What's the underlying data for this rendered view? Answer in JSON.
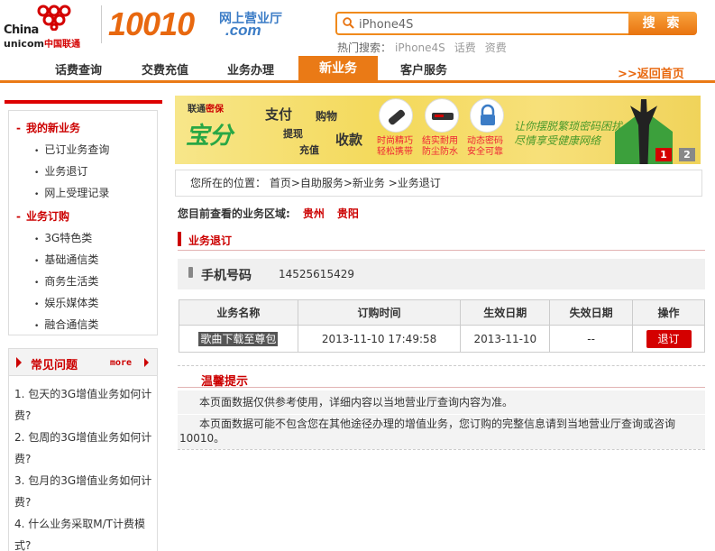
{
  "brand": {
    "china": "China",
    "unicom": "unicom",
    "unicom_cn": "中国联通",
    "number": "10010",
    "top": "网上营业厅",
    "com": ".com"
  },
  "search": {
    "value": "iPhone4S",
    "button": "搜 索",
    "hot_label": "热门搜索：",
    "hot": [
      "iPhone4S",
      "话费",
      "资费"
    ]
  },
  "nav": {
    "items": [
      "话费查询",
      "交费充值",
      "业务办理",
      "新业务",
      "客户服务"
    ],
    "home": ">>返回首页"
  },
  "sidebar": {
    "my_business": "我的新业务",
    "my_items": [
      "已订业务查询",
      "业务退订",
      "网上受理记录"
    ],
    "order": "业务订购",
    "order_items": [
      "3G特色类",
      "基础通信类",
      "商务生活类",
      "娱乐媒体类",
      "融合通信类"
    ]
  },
  "faq": {
    "title": "常见问题",
    "more": "more",
    "items": [
      "1. 包天的3G增值业务如何计费?",
      "2. 包周的3G增值业务如何计费?",
      "3. 包月的3G增值业务如何计费?",
      "4. 什么业务采取M/T计费模式?"
    ]
  },
  "banner": {
    "logo_a": "联通",
    "logo_b": "密保",
    "bao": "宝分",
    "words": [
      "支付",
      "购物",
      "提现",
      "充值",
      "收款"
    ],
    "captions": [
      [
        "时尚精巧",
        "轻松携带"
      ],
      [
        "结实耐用",
        "防尘防水"
      ],
      [
        "动态密码",
        "安全可靠"
      ]
    ],
    "slogan": [
      "让你摆脱繁琐密码困扰",
      "尽情享受健康网络"
    ],
    "pages": [
      "1",
      "2"
    ]
  },
  "breadcrumb": "您所在的位置：  首页>自助服务>新业务 >业务退订",
  "region": {
    "label": "您目前查看的业务区域:",
    "province": "贵州",
    "city": "贵阳"
  },
  "section_title": "业务退订",
  "phone": {
    "label": "手机号码",
    "value": "14525615429"
  },
  "table": {
    "headers": [
      "业务名称",
      "订购时间",
      "生效日期",
      "失效日期",
      "操作"
    ],
    "rows": [
      {
        "name": "歌曲下载至尊包",
        "order_time": "2013-11-10 17:49:58",
        "effective": "2013-11-10",
        "expire": "--",
        "action": "退订"
      }
    ]
  },
  "tips": {
    "title": "温馨提示",
    "line1": "本页面数据仅供参考使用，详细内容以当地营业厅查询内容为准。",
    "line2a": "本页面数据可能不包含您在其他途径办理的增值业务，您订购的完整信息请到当地营业厅查询或咨询",
    "line2b": "10010。"
  },
  "colors": {
    "accent": "#ea7a16",
    "red": "#c00000",
    "brand_blue": "#3b7cc6"
  }
}
